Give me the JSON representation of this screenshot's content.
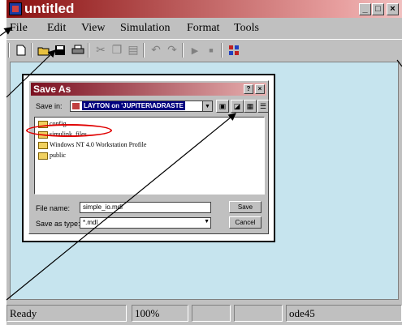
{
  "window": {
    "title": "untitled",
    "controls": [
      "_",
      "□",
      "×"
    ]
  },
  "menu": [
    "File",
    "Edit",
    "View",
    "Simulation",
    "Format",
    "Tools"
  ],
  "toolbar": [
    "new-document",
    "open-folder",
    "save",
    "print",
    "cut",
    "copy",
    "paste",
    "undo",
    "redo",
    "start-simulation",
    "stop-simulation",
    "library-browser"
  ],
  "status": {
    "state": "Ready",
    "zoom": "100%",
    "solver": "ode45"
  },
  "save_dialog": {
    "title": "Save As",
    "save_in_label": "Save in:",
    "save_in_value": "LAYTON on 'JUPITER\\ADRASTE",
    "files": [
      "config",
      "simulink_files",
      "Windows NT 4.0 Workstation Profile",
      "public"
    ],
    "file_name_label": "File name:",
    "file_name_value": "simple_io.mdl",
    "save_as_type_label": "Save as type:",
    "save_as_type_value": "*.mdl",
    "save_button": "Save",
    "cancel_button": "Cancel",
    "help_button": "?",
    "close_button": "×"
  }
}
